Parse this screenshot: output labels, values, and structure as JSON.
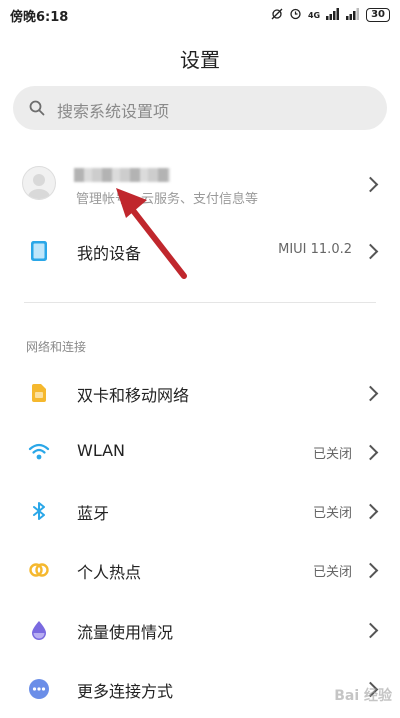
{
  "status_bar": {
    "time": "傍晚6:18",
    "signal_label": "4G",
    "battery": "30"
  },
  "header": {
    "title": "设置"
  },
  "search": {
    "placeholder": "搜索系统设置项"
  },
  "account": {
    "subtitle": "管理帐号、云服务、支付信息等"
  },
  "device": {
    "label": "我的设备",
    "value": "MIUI 11.0.2"
  },
  "section": {
    "network_title": "网络和连接"
  },
  "network_items": [
    {
      "label": "双卡和移动网络",
      "value": "",
      "icon": "sim-card-icon",
      "color": "#f5b82e"
    },
    {
      "label": "WLAN",
      "value": "已关闭",
      "icon": "wifi-icon",
      "color": "#2aa7e8"
    },
    {
      "label": "蓝牙",
      "value": "已关闭",
      "icon": "bluetooth-icon",
      "color": "#2aa7e8"
    },
    {
      "label": "个人热点",
      "value": "已关闭",
      "icon": "hotspot-icon",
      "color": "#f5b82e"
    },
    {
      "label": "流量使用情况",
      "value": "",
      "icon": "data-usage-icon",
      "color": "#7a6ae0"
    },
    {
      "label": "更多连接方式",
      "value": "",
      "icon": "more-connections-icon",
      "color": "#6b8ee8"
    }
  ],
  "colors": {
    "annotation_arrow": "#c0272d",
    "device_icon": "#2aa7e8"
  },
  "watermark": "Bai 经验"
}
